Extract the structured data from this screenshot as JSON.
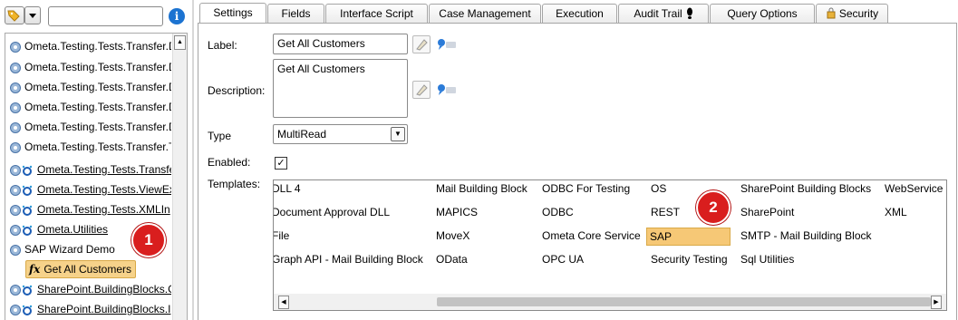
{
  "left_panel": {
    "search": {
      "placeholder": ""
    },
    "info_label": "i",
    "tree_items": [
      {
        "label": "Ometa.Testing.Tests.Transfer.D",
        "icon": "gear-icon",
        "link": false
      },
      {
        "label": "Ometa.Testing.Tests.Transfer.D",
        "icon": "gear-icon",
        "link": false
      },
      {
        "label": "Ometa.Testing.Tests.Transfer.D",
        "icon": "gear-icon",
        "link": false
      },
      {
        "label": "Ometa.Testing.Tests.Transfer.D",
        "icon": "gear-icon",
        "link": false
      },
      {
        "label": "Ometa.Testing.Tests.Transfer.D",
        "icon": "gear-icon",
        "link": false
      },
      {
        "label": "Ometa.Testing.Tests.Transfer.T",
        "icon": "gear-icon",
        "link": false
      },
      {
        "label": "Ometa.Testing.Tests.Transfe",
        "icon": "gear-link-icon",
        "link": true
      },
      {
        "label": "Ometa.Testing.Tests.ViewEx",
        "icon": "gear-link-icon",
        "link": true
      },
      {
        "label": "Ometa.Testing.Tests.XMLIn",
        "icon": "gear-link-icon",
        "link": true
      },
      {
        "label": "Ometa.Utilities",
        "icon": "gear-link-icon",
        "link": true
      },
      {
        "label": "SAP Wizard Demo",
        "icon": "gear-icon",
        "link": false
      },
      {
        "label": "Get All Customers",
        "icon": "fx-icon",
        "fx": "fx",
        "link": false,
        "selected": true
      },
      {
        "label": "SharePoint.BuildingBlocks.C",
        "icon": "gear-link-icon",
        "link": true
      },
      {
        "label": "SharePoint.BuildingBlocks.I",
        "icon": "gear-link-icon",
        "link": true
      }
    ],
    "badge_1": "1"
  },
  "tabs": [
    {
      "label": "Settings",
      "active": true
    },
    {
      "label": "Fields"
    },
    {
      "label": "Interface Script"
    },
    {
      "label": "Case Management"
    },
    {
      "label": "Execution"
    },
    {
      "label": "Audit Trail",
      "icon": "footprint-icon"
    },
    {
      "label": "Query Options"
    },
    {
      "label": "Security",
      "icon": "lock-icon"
    }
  ],
  "settings": {
    "label_caption": "Label:",
    "label_value": "Get All Customers",
    "description_caption": "Description:",
    "description_value": "Get All Customers",
    "type_caption": "Type",
    "type_value": "MultiRead",
    "enabled_caption": "Enabled:",
    "enabled_check": "✓",
    "templates_caption": "Templates:",
    "templates": [
      [
        "DLL 4",
        "Mail Building Block",
        "ODBC For Testing",
        "OS",
        "SharePoint Building Blocks",
        "WebService"
      ],
      [
        "Document Approval DLL",
        "MAPICS",
        "ODBC",
        "REST",
        "SharePoint",
        "XML"
      ],
      [
        "File",
        "MoveX",
        "Ometa Core Service",
        "SAP",
        "SMTP - Mail Building Block",
        ""
      ],
      [
        "Graph API - Mail Building Block",
        "OData",
        "OPC UA",
        "Security Testing",
        "Sql Utilities",
        ""
      ]
    ],
    "selected_template": "SAP",
    "badge_2": "2"
  },
  "colors": {
    "selection": "#f6c876",
    "badge": "#d91e1e",
    "info": "#1c73d1"
  }
}
